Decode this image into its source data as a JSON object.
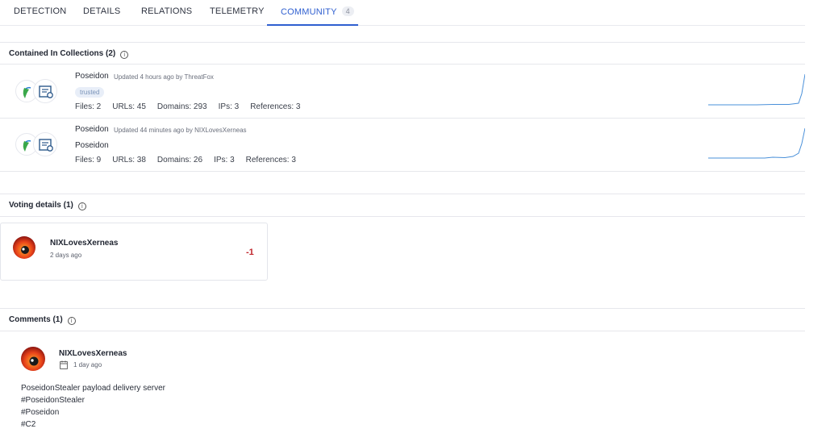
{
  "tabs": [
    {
      "label": "DETECTION"
    },
    {
      "label": "DETAILS"
    },
    {
      "label": "RELATIONS"
    },
    {
      "label": "TELEMETRY"
    },
    {
      "label": "COMMUNITY",
      "badge": "4",
      "active": true
    }
  ],
  "collections": {
    "title": "Contained In Collections",
    "count": "(2)",
    "items": [
      {
        "name": "Poseidon",
        "updated": "Updated 4 hours ago by ThreatFox",
        "tag": "trusted",
        "files": "Files: 2",
        "urls": "URLs: 45",
        "domains": "Domains: 293",
        "ips": "IPs: 3",
        "references": "References: 3"
      },
      {
        "name": "Poseidon",
        "updated": "Updated 44 minutes ago by NIXLovesXerneas",
        "description": "Poseidon",
        "files": "Files: 9",
        "urls": "URLs: 38",
        "domains": "Domains: 26",
        "ips": "IPs: 3",
        "references": "References: 3"
      }
    ]
  },
  "voting": {
    "title": "Voting details",
    "count": "(1)",
    "votes": [
      {
        "user": "NIXLovesXerneas",
        "time": "2 days ago",
        "value": "-1"
      }
    ]
  },
  "comments": {
    "title": "Comments",
    "count": "(1)",
    "items": [
      {
        "user": "NIXLovesXerneas",
        "time": "1 day ago",
        "lines": [
          "PoseidonStealer payload delivery server",
          "#PoseidonStealer",
          "#Poseidon",
          "#C2"
        ]
      }
    ]
  },
  "colors": {
    "accent": "#2f5fd0",
    "negative_vote": "#c0262d",
    "sparkline": "#4a90d9"
  },
  "icons": [
    "info-icon",
    "collection-logo-icon",
    "collection-document-icon",
    "calendar-icon",
    "user-avatar"
  ]
}
